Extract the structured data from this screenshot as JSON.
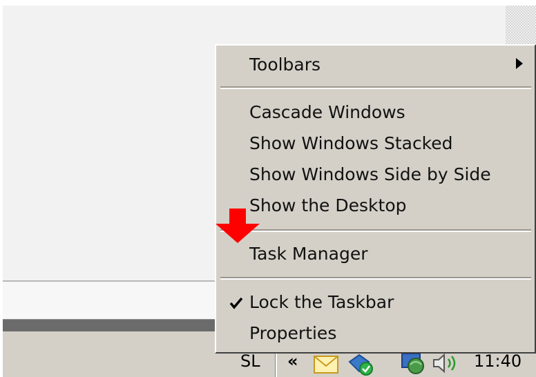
{
  "context_menu": {
    "items": [
      {
        "label": "Toolbars",
        "submenu": true
      },
      {
        "label": "Cascade Windows"
      },
      {
        "label": "Show Windows Stacked"
      },
      {
        "label": "Show Windows Side by Side"
      },
      {
        "label": "Show the Desktop"
      },
      {
        "label": "Task Manager"
      },
      {
        "label": "Lock the Taskbar",
        "checked": true
      },
      {
        "label": "Properties"
      }
    ]
  },
  "taskbar": {
    "language": "SL",
    "chevron": "«",
    "clock": "11:40"
  },
  "icons": [
    "chevron-right-icon",
    "checkmark-icon",
    "red-down-arrow-icon",
    "envelope-icon",
    "security-shield-icon",
    "network-icon",
    "speaker-icon"
  ],
  "colors": {
    "menu_bg": "#d4d0c8",
    "highlight_arrow": "#ff0000",
    "taskbar": "#d4d0c8"
  }
}
